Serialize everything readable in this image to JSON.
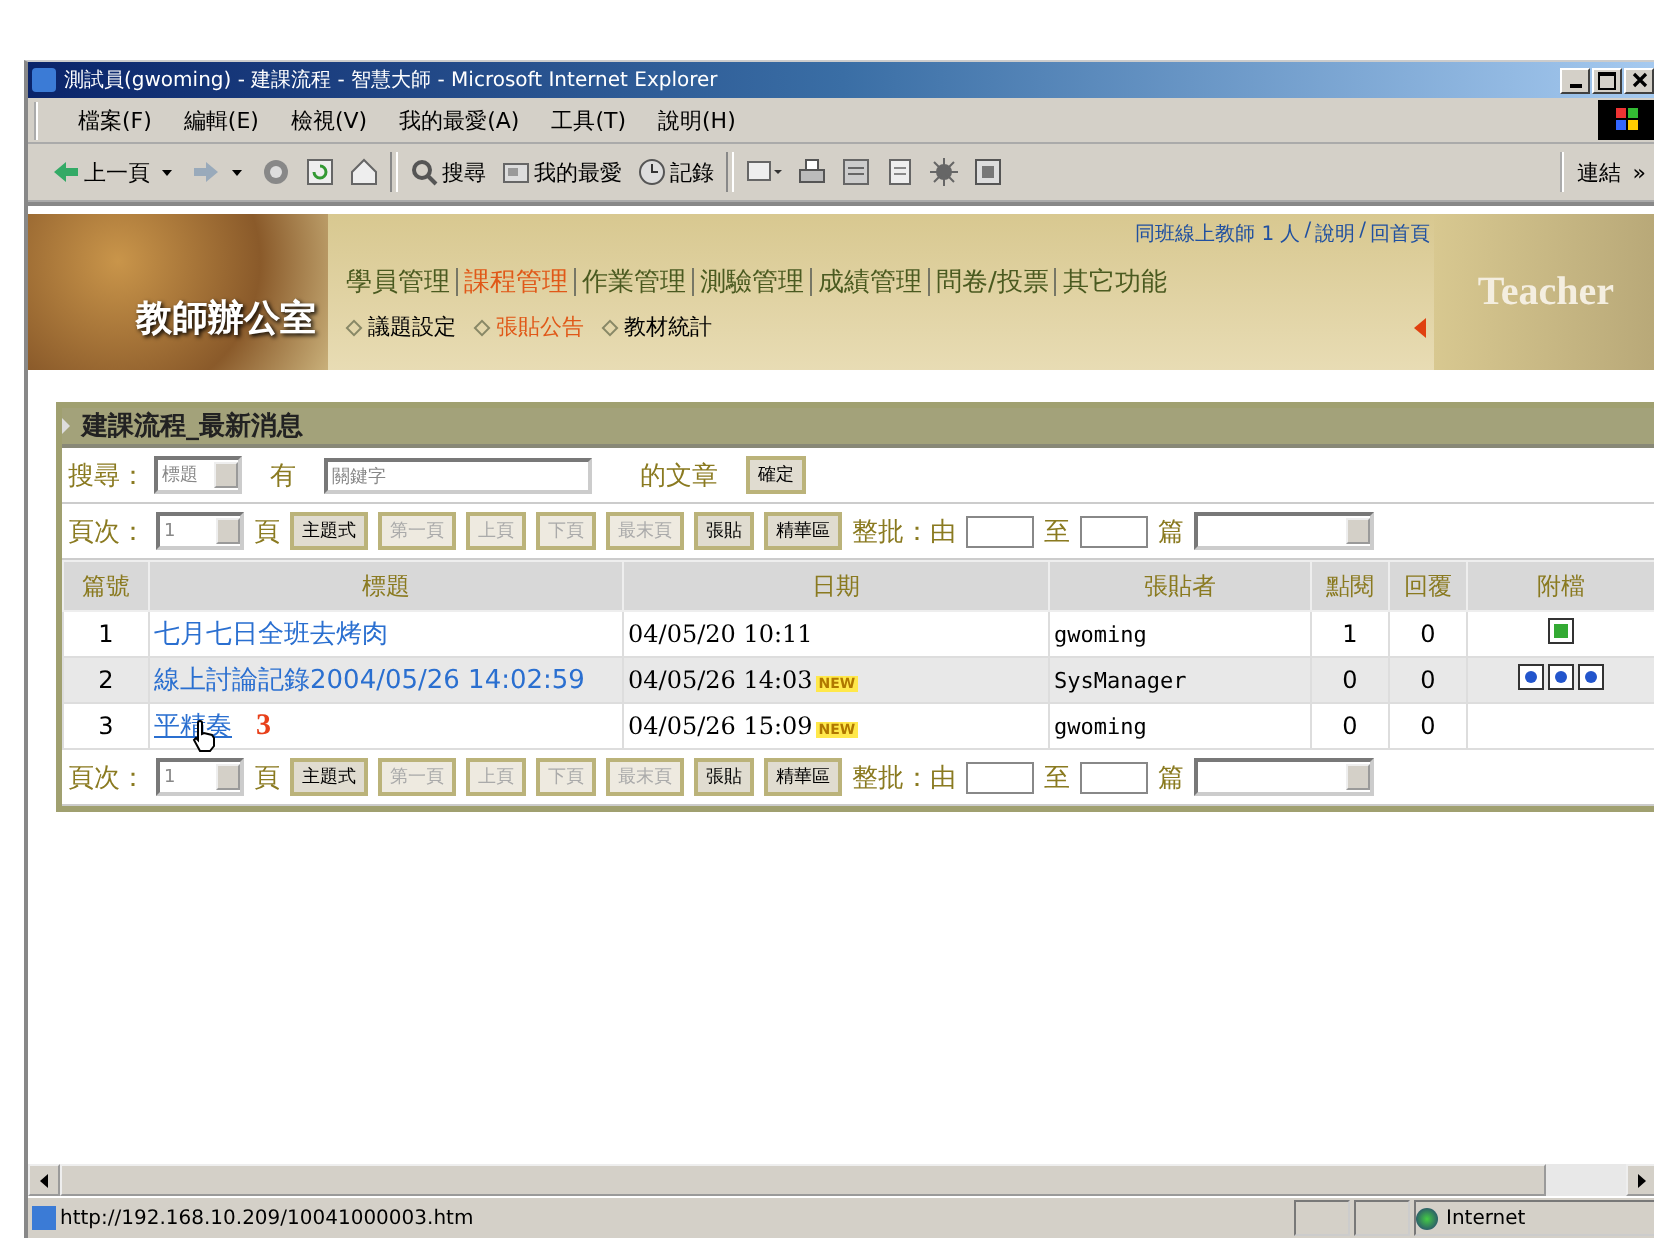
{
  "window": {
    "title": "測試員(gwoming) - 建課流程 - 智慧大師 - Microsoft Internet Explorer"
  },
  "menu": [
    "檔案(F)",
    "編輯(E)",
    "檢視(V)",
    "我的最愛(A)",
    "工具(T)",
    "說明(H)"
  ],
  "toolbar": [
    {
      "kind": "back",
      "label": "上一頁"
    },
    {
      "kind": "forward"
    },
    {
      "kind": "stop"
    },
    {
      "kind": "refresh"
    },
    {
      "kind": "home"
    },
    {
      "kind": "search",
      "label": "搜尋"
    },
    {
      "kind": "favorites",
      "label": "我的最愛"
    },
    {
      "kind": "history",
      "label": "記錄"
    },
    {
      "kind": "mail"
    },
    {
      "kind": "print"
    },
    {
      "kind": "edit"
    },
    {
      "kind": "discuss"
    },
    {
      "kind": "messenger"
    },
    {
      "kind": "media"
    }
  ],
  "links": {
    "label": "連結",
    "chevron": "»"
  },
  "header": {
    "logo": "教師辦公室",
    "banner_word": "Teacher",
    "top_links": [
      "同班線上教師 1 人",
      "說明",
      "回首頁"
    ],
    "top_links_separator": "/",
    "nav": [
      {
        "label": "學員管理",
        "selected": false
      },
      {
        "label": "課程管理",
        "selected": true
      },
      {
        "label": "作業管理",
        "selected": false
      },
      {
        "label": "測驗管理",
        "selected": false
      },
      {
        "label": "成績管理",
        "selected": false
      },
      {
        "label": "問卷/投票",
        "selected": false
      },
      {
        "label": "其它功能",
        "selected": false
      }
    ],
    "subnav": [
      {
        "label": "議題設定",
        "selected": false
      },
      {
        "label": "張貼公告",
        "selected": true
      },
      {
        "label": "教材統計",
        "selected": false
      }
    ]
  },
  "panel": {
    "title": "建課流程_最新消息",
    "search": {
      "label": "搜尋：",
      "field": "標題",
      "between": "有",
      "placeholder": "關鍵字",
      "after": "的文章",
      "button": "確定"
    },
    "pagers": [
      {
        "label": "頁次：",
        "page": "1",
        "unit": "頁",
        "buttons": [
          {
            "label": "主題式",
            "disabled": false
          },
          {
            "label": "第一頁",
            "disabled": true
          },
          {
            "label": "上頁",
            "disabled": true
          },
          {
            "label": "下頁",
            "disabled": true
          },
          {
            "label": "最末頁",
            "disabled": true
          },
          {
            "label": "張貼",
            "disabled": false
          },
          {
            "label": "精華區",
            "disabled": false
          }
        ],
        "batch_from": "整批：由",
        "batch_to": "至",
        "batch_unit": "篇"
      },
      {
        "label": "頁次：",
        "page": "1",
        "unit": "頁",
        "buttons": [
          {
            "label": "主題式",
            "disabled": false
          },
          {
            "label": "第一頁",
            "disabled": true
          },
          {
            "label": "上頁",
            "disabled": true
          },
          {
            "label": "下頁",
            "disabled": true
          },
          {
            "label": "最末頁",
            "disabled": true
          },
          {
            "label": "張貼",
            "disabled": false
          },
          {
            "label": "精華區",
            "disabled": false
          }
        ],
        "batch_from": "整批：由",
        "batch_to": "至",
        "batch_unit": "篇"
      }
    ],
    "columns": [
      "篇號",
      "標題",
      "日期",
      "張貼者",
      "點閱",
      "回覆",
      "附檔"
    ],
    "rows": [
      {
        "no": "1",
        "title": "七月七日全班去烤肉",
        "date": "04/05/20 10:11",
        "author": "gwoming",
        "views": "1",
        "replies": "0",
        "hover": false,
        "attachments": [
          {
            "kind": "image"
          }
        ]
      },
      {
        "no": "2",
        "title": "線上討論記錄2004/05/26 14:02:59",
        "date": "04/05/26 14:03",
        "badge": "NEW",
        "author": "SysManager",
        "views": "0",
        "replies": "0",
        "hover": false,
        "attachments": [
          {
            "kind": "web"
          },
          {
            "kind": "web"
          },
          {
            "kind": "web"
          }
        ]
      },
      {
        "no": "3",
        "title": "平精奏",
        "date": "04/05/26 15:09",
        "badge": "NEW",
        "author": "gwoming",
        "views": "0",
        "replies": "0",
        "hover": true,
        "annotation": "3",
        "attachments": []
      }
    ]
  },
  "status_bar": {
    "url": "http://192.168.10.209/10041000003.htm",
    "zone": "Internet"
  }
}
